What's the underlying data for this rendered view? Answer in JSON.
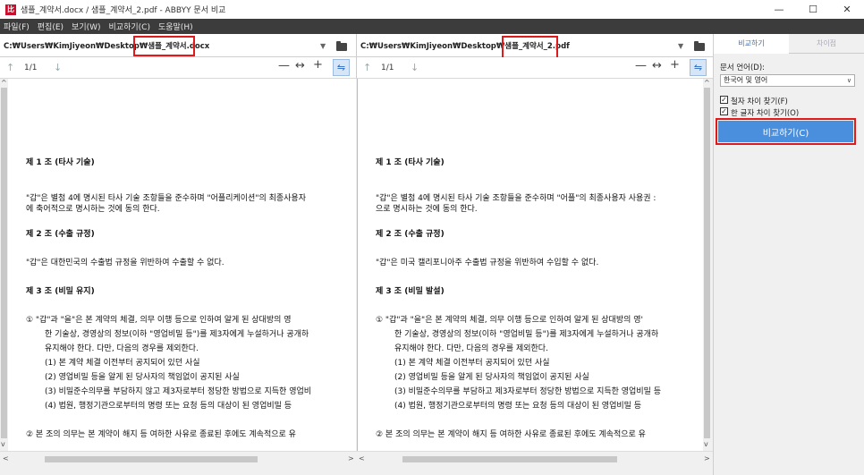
{
  "window": {
    "title": "샘플_계약서.docx / 샘플_계약서_2.pdf - ABBYY 문서 비교",
    "app_icon_glyph": "比",
    "minimize_glyph": "—",
    "maximize_glyph": "☐",
    "close_glyph": "✕"
  },
  "menu": {
    "items": [
      "파일(F)",
      "편집(E)",
      "보기(W)",
      "비교하기(C)",
      "도움말(H)"
    ]
  },
  "left_pane": {
    "path": "C:₩Users₩KimJiyeon₩Desktop₩샘플_계약서.docx",
    "page_indicator": "1/1",
    "paragraphs": [
      {
        "text": "제 1 조  (타사 기술)",
        "heading": true
      },
      {
        "text": "\"갑\"은 별첨 4에 명시된 타사 기술 조항들을 준수하며 \"어플리케이션\"의 최종사용자",
        "heading": false
      },
      {
        "text": "에 축어적으로 명시하는 것에 동의 한다.",
        "heading": false
      },
      {
        "text": "제 2 조  (수출 규정)",
        "heading": true
      },
      {
        "text": "\"갑\"은 대한민국의 수출법 규정을 위반하여 수출할 수 없다.",
        "heading": false
      },
      {
        "text": "제 3 조  (비밀 유지)",
        "heading": true
      },
      {
        "text": "①   \"갑\"과 \"을\"은 본 계약의 체결, 의무 이행 등으로 인하여 알게 된 상대방의 영",
        "heading": false
      },
      {
        "text": "한 기술상, 경영상의 정보(이하 \"영업비밀 등\")를 제3자에게 누설하거나 공개하",
        "heading": false
      },
      {
        "text": "유지해야 한다. 다만, 다음의 경우를 제외한다.",
        "heading": false
      },
      {
        "text": "(1)  본 계약 체결 이전부터 공지되어 있던 사실",
        "heading": false
      },
      {
        "text": "(2)  영업비밀 등을 알게 된 당사자의 책임없이 공지된 사실",
        "heading": false
      },
      {
        "text": "(3)  비밀준수의무를 부담하지 않고 제3자로부터 정당한 방법으로 지득한 영업비",
        "heading": false
      },
      {
        "text": "(4)  법원, 행정기관으로부터의 명령 또는 요청 등의 대상이 된 영업비밀 등",
        "heading": false
      },
      {
        "text": "②  본 조의 의무는 본 계약이 해지 등 여하한 사유로 종료된 후에도 계속적으로 유",
        "heading": false
      }
    ]
  },
  "right_pane": {
    "path": "C:₩Users₩KimJiyeon₩Desktop₩샘플_계약서_2.pdf",
    "page_indicator": "1/1",
    "paragraphs": [
      {
        "text": "제 1 조  (타사 기술)",
        "heading": true
      },
      {
        "text": "\"갑\"은 별첨 4에 명시된 타사 기술 조항들을 준수하며 \"어플\"의 최종사용자 사용권 :",
        "heading": false
      },
      {
        "text": "으로 명시하는 것에 동의 한다.",
        "heading": false
      },
      {
        "text": "제 2 조  (수출 규정)",
        "heading": true
      },
      {
        "text": "\"갑\"은 미국 캘리포니아주 수출법 규정을 위반하여 수입할 수 없다.",
        "heading": false
      },
      {
        "text": "제 3 조  (비밀 발설)",
        "heading": true
      },
      {
        "text": "①   \"갑\"과 \"을\"은 본 계약의 체결, 의무 이행 등으로 인하여 알게 된 상대방의 영'",
        "heading": false
      },
      {
        "text": "한 기술상, 경영상의 정보(이하 \"영업비밀 등\")를 제3자에게 누설하거나 공개하",
        "heading": false
      },
      {
        "text": "유지해야 한다. 다만, 다음의 경우를 제외한다.",
        "heading": false
      },
      {
        "text": "(1)  본 계약 체결 이전부터 공지되어 있던 사실",
        "heading": false
      },
      {
        "text": "(2)  영업비밀 등을 알게 된 당사자의 책임없이 공지된 사실",
        "heading": false
      },
      {
        "text": "(3)  비밀준수의무를 부담하고 제3자로부터 정당한 방법으로 지득한 영업비밀 등",
        "heading": false
      },
      {
        "text": "(4)  법원, 행정기관으로부터의 명령 또는 요청 등의 대상이 된 영업비밀 등",
        "heading": false
      },
      {
        "text": "②  본 조의 의무는 본 계약이 해지 등 여하한 사유로 종료된 후에도 계속적으로 유",
        "heading": false
      }
    ]
  },
  "toolbar": {
    "up_glyph": "↑",
    "down_glyph": "↓",
    "zoom_out_glyph": "—",
    "fit_glyph": "↔",
    "zoom_in_glyph": "+",
    "sync_glyph": "⇋",
    "dropdown_glyph": "▼"
  },
  "sidebar": {
    "tabs": [
      "비교하기",
      "차이점"
    ],
    "language_label": "문서 언어(D):",
    "language_value": "한국어 및 영어",
    "checkbox_punct": "철자 차이 찾기(F)",
    "checkbox_char": "한 글자 차이 찾기(O)",
    "checkbox_mark": "✓",
    "compare_button": "비교하기(C)"
  },
  "colors": {
    "accent": "#4a8fdd",
    "highlight": "#e0191b",
    "menubar": "#3c3c3c"
  }
}
